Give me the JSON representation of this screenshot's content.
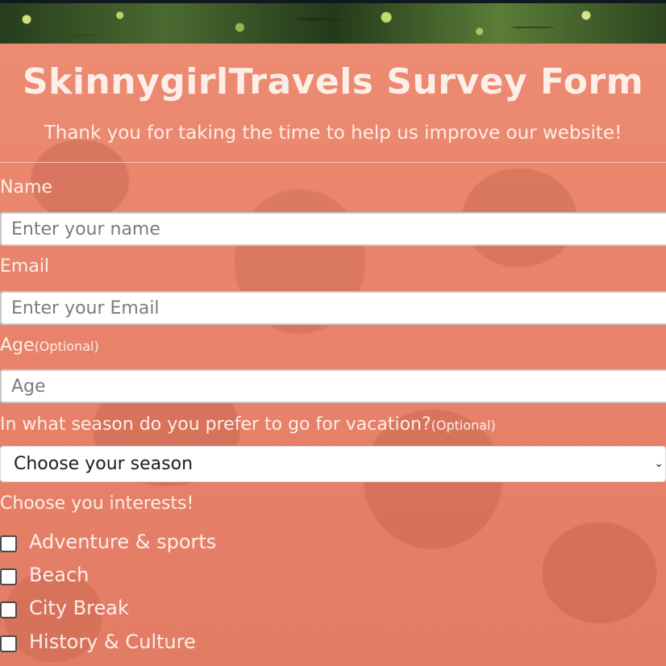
{
  "header": {
    "title": "SkinnygirlTravels Survey Form",
    "subtitle": "Thank you for taking the time to help us improve our website!"
  },
  "form": {
    "name": {
      "label": "Name",
      "placeholder": "Enter your name"
    },
    "email": {
      "label": "Email",
      "placeholder": "Enter your Email"
    },
    "age": {
      "label": "Age",
      "optional": "(Optional)",
      "placeholder": "Age"
    },
    "season": {
      "label": "In what season do you prefer to go for vacation?",
      "optional": "(Optional)",
      "selected": "Choose your season"
    },
    "interests": {
      "label": "Choose you interests!",
      "items": [
        {
          "label": "Adventure & sports",
          "checked": false
        },
        {
          "label": "Beach",
          "checked": false
        },
        {
          "label": "City Break",
          "checked": false
        },
        {
          "label": "History & Culture",
          "checked": false
        }
      ]
    }
  },
  "colors": {
    "background": "#e8836b",
    "text": "#fdeee8",
    "input_bg": "#ffffff"
  },
  "icons": {
    "select_chevron": "chevron-down-icon"
  }
}
